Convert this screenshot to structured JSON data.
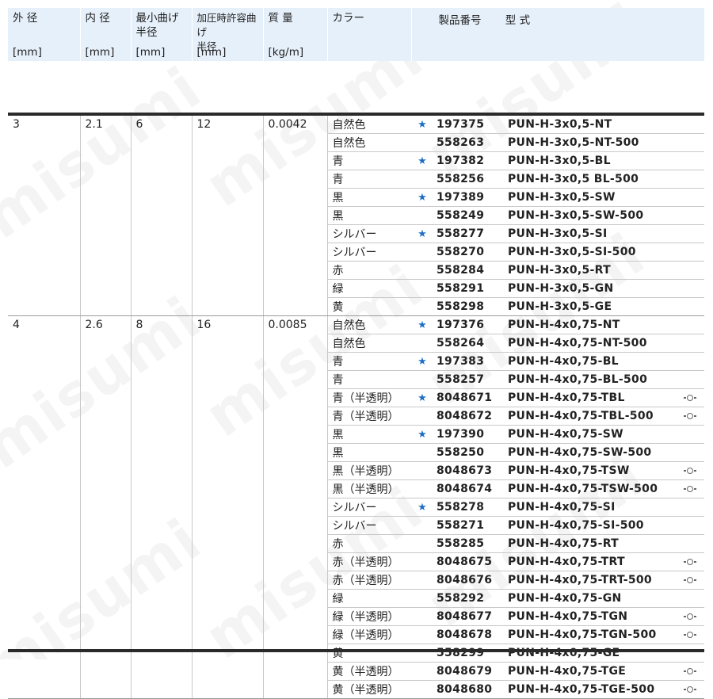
{
  "watermark": "misumi",
  "header": {
    "outer_diameter": "外 径",
    "inner_diameter": "内 径",
    "min_bend_1": "最小曲げ",
    "min_bend_2": "半径",
    "allow_bend_1": "加圧時許容曲げ",
    "allow_bend_2": "半径",
    "mass": "質 量",
    "color": "カラー",
    "product_number": "製品番号",
    "model": "型 式",
    "unit_mm": "[mm]",
    "unit_mass": "[kg/m]"
  },
  "groups": [
    {
      "outer_diameter": "3",
      "inner_diameter": "2.1",
      "min_bend_radius": "6",
      "allow_bend_radius": "12",
      "mass": "0.0042",
      "rows": [
        {
          "color": "自然色",
          "star": true,
          "part": "197375",
          "model": "PUN-H-3x0,5-NT",
          "icon": false
        },
        {
          "color": "自然色",
          "star": false,
          "part": "558263",
          "model": "PUN-H-3x0,5-NT-500",
          "icon": false
        },
        {
          "color": "青",
          "star": true,
          "part": "197382",
          "model": "PUN-H-3x0,5-BL",
          "icon": false
        },
        {
          "color": "青",
          "star": false,
          "part": "558256",
          "model": "PUN-H-3x0,5 BL-500",
          "icon": false
        },
        {
          "color": "黒",
          "star": true,
          "part": "197389",
          "model": "PUN-H-3x0,5-SW",
          "icon": false
        },
        {
          "color": "黒",
          "star": false,
          "part": "558249",
          "model": "PUN-H-3x0,5-SW-500",
          "icon": false
        },
        {
          "color": "シルバー",
          "star": true,
          "part": "558277",
          "model": "PUN-H-3x0,5-SI",
          "icon": false
        },
        {
          "color": "シルバー",
          "star": false,
          "part": "558270",
          "model": "PUN-H-3x0,5-SI-500",
          "icon": false
        },
        {
          "color": "赤",
          "star": false,
          "part": "558284",
          "model": "PUN-H-3x0,5-RT",
          "icon": false
        },
        {
          "color": "緑",
          "star": false,
          "part": "558291",
          "model": "PUN-H-3x0,5-GN",
          "icon": false
        },
        {
          "color": "黄",
          "star": false,
          "part": "558298",
          "model": "PUN-H-3x0,5-GE",
          "icon": false
        }
      ]
    },
    {
      "outer_diameter": "4",
      "inner_diameter": "2.6",
      "min_bend_radius": "8",
      "allow_bend_radius": "16",
      "mass": "0.0085",
      "rows": [
        {
          "color": "自然色",
          "star": true,
          "part": "197376",
          "model": "PUN-H-4x0,75-NT",
          "icon": false
        },
        {
          "color": "自然色",
          "star": false,
          "part": "558264",
          "model": "PUN-H-4x0,75-NT-500",
          "icon": false
        },
        {
          "color": "青",
          "star": true,
          "part": "197383",
          "model": "PUN-H-4x0,75-BL",
          "icon": false
        },
        {
          "color": "青",
          "star": false,
          "part": "558257",
          "model": "PUN-H-4x0,75-BL-500",
          "icon": false
        },
        {
          "color": "青（半透明）",
          "star": true,
          "part": "8048671",
          "model": "PUN-H-4x0,75-TBL",
          "icon": true
        },
        {
          "color": "青（半透明）",
          "star": false,
          "part": "8048672",
          "model": "PUN-H-4x0,75-TBL-500",
          "icon": true
        },
        {
          "color": "黒",
          "star": true,
          "part": "197390",
          "model": "PUN-H-4x0,75-SW",
          "icon": false
        },
        {
          "color": "黒",
          "star": false,
          "part": "558250",
          "model": "PUN-H-4x0,75-SW-500",
          "icon": false
        },
        {
          "color": "黒（半透明）",
          "star": false,
          "part": "8048673",
          "model": "PUN-H-4x0,75-TSW",
          "icon": true
        },
        {
          "color": "黒（半透明）",
          "star": false,
          "part": "8048674",
          "model": "PUN-H-4x0,75-TSW-500",
          "icon": true
        },
        {
          "color": "シルバー",
          "star": true,
          "part": "558278",
          "model": "PUN-H-4x0,75-SI",
          "icon": false
        },
        {
          "color": "シルバー",
          "star": false,
          "part": "558271",
          "model": "PUN-H-4x0,75-SI-500",
          "icon": false
        },
        {
          "color": "赤",
          "star": false,
          "part": "558285",
          "model": "PUN-H-4x0,75-RT",
          "icon": false
        },
        {
          "color": "赤（半透明）",
          "star": false,
          "part": "8048675",
          "model": "PUN-H-4x0,75-TRT",
          "icon": true
        },
        {
          "color": "赤（半透明）",
          "star": false,
          "part": "8048676",
          "model": "PUN-H-4x0,75-TRT-500",
          "icon": true
        },
        {
          "color": "緑",
          "star": false,
          "part": "558292",
          "model": "PUN-H-4x0,75-GN",
          "icon": false
        },
        {
          "color": "緑（半透明）",
          "star": false,
          "part": "8048677",
          "model": "PUN-H-4x0,75-TGN",
          "icon": true
        },
        {
          "color": "緑（半透明）",
          "star": false,
          "part": "8048678",
          "model": "PUN-H-4x0,75-TGN-500",
          "icon": true
        },
        {
          "color": "黄",
          "star": false,
          "part": "558299",
          "model": "PUN-H-4x0,75-GE",
          "icon": false
        },
        {
          "color": "黄（半透明）",
          "star": false,
          "part": "8048679",
          "model": "PUN-H-4x0,75-TGE",
          "icon": true
        },
        {
          "color": "黄（半透明）",
          "star": false,
          "part": "8048680",
          "model": "PUN-H-4x0,75-TGE-500",
          "icon": true
        }
      ]
    }
  ],
  "colors": {
    "header_bg": "#e6f0fa",
    "star": "#1e6fc4",
    "rule": "#2a2a2a"
  },
  "icons": {
    "star": "star-icon",
    "transparent_marker": "eye-icon"
  }
}
